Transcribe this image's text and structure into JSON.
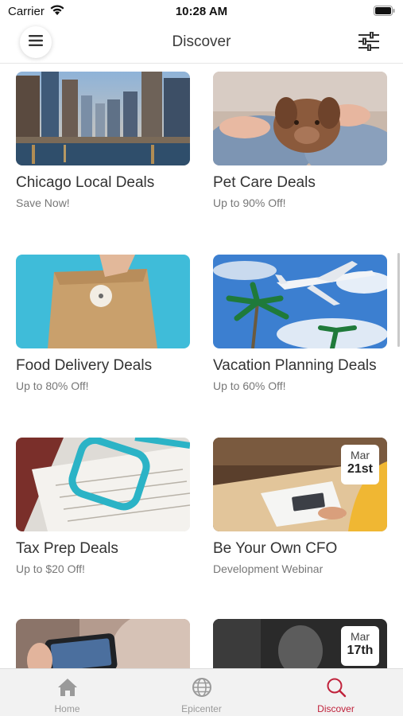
{
  "status_bar": {
    "carrier": "Carrier",
    "time": "10:28 AM"
  },
  "header": {
    "title": "Discover",
    "menu_icon": "hamburger-menu-icon",
    "filter_icon": "sliders-icon"
  },
  "cards": [
    {
      "title": "Chicago Local Deals",
      "subtitle": "Save Now!",
      "image": "chicago-city-photo"
    },
    {
      "title": "Pet Care Deals",
      "subtitle": "Up to 90% Off!",
      "image": "puppy-photo"
    },
    {
      "title": "Food Delivery Deals",
      "subtitle": "Up to 80% Off!",
      "image": "paper-bag-photo"
    },
    {
      "title": "Vacation Planning Deals",
      "subtitle": "Up to 60% Off!",
      "image": "airplane-palm-photo"
    },
    {
      "title": "Tax Prep Deals",
      "subtitle": "Up to $20 Off!",
      "image": "tax-form-glasses-photo"
    },
    {
      "title": "Be Your Own CFO",
      "subtitle": "Development Webinar",
      "image": "desk-calculator-photo",
      "badge": {
        "month": "Mar",
        "day": "21st"
      }
    },
    {
      "title": "",
      "subtitle": "",
      "image": "phone-photo"
    },
    {
      "title": "",
      "subtitle": "",
      "image": "person-dark-photo",
      "badge": {
        "month": "Mar",
        "day": "17th"
      }
    }
  ],
  "tab_bar": {
    "active_color": "#c0223b",
    "items": [
      {
        "label": "Home",
        "icon": "house-icon"
      },
      {
        "label": "Epicenter",
        "icon": "globe-icon"
      },
      {
        "label": "Discover",
        "icon": "search-icon"
      }
    ]
  }
}
